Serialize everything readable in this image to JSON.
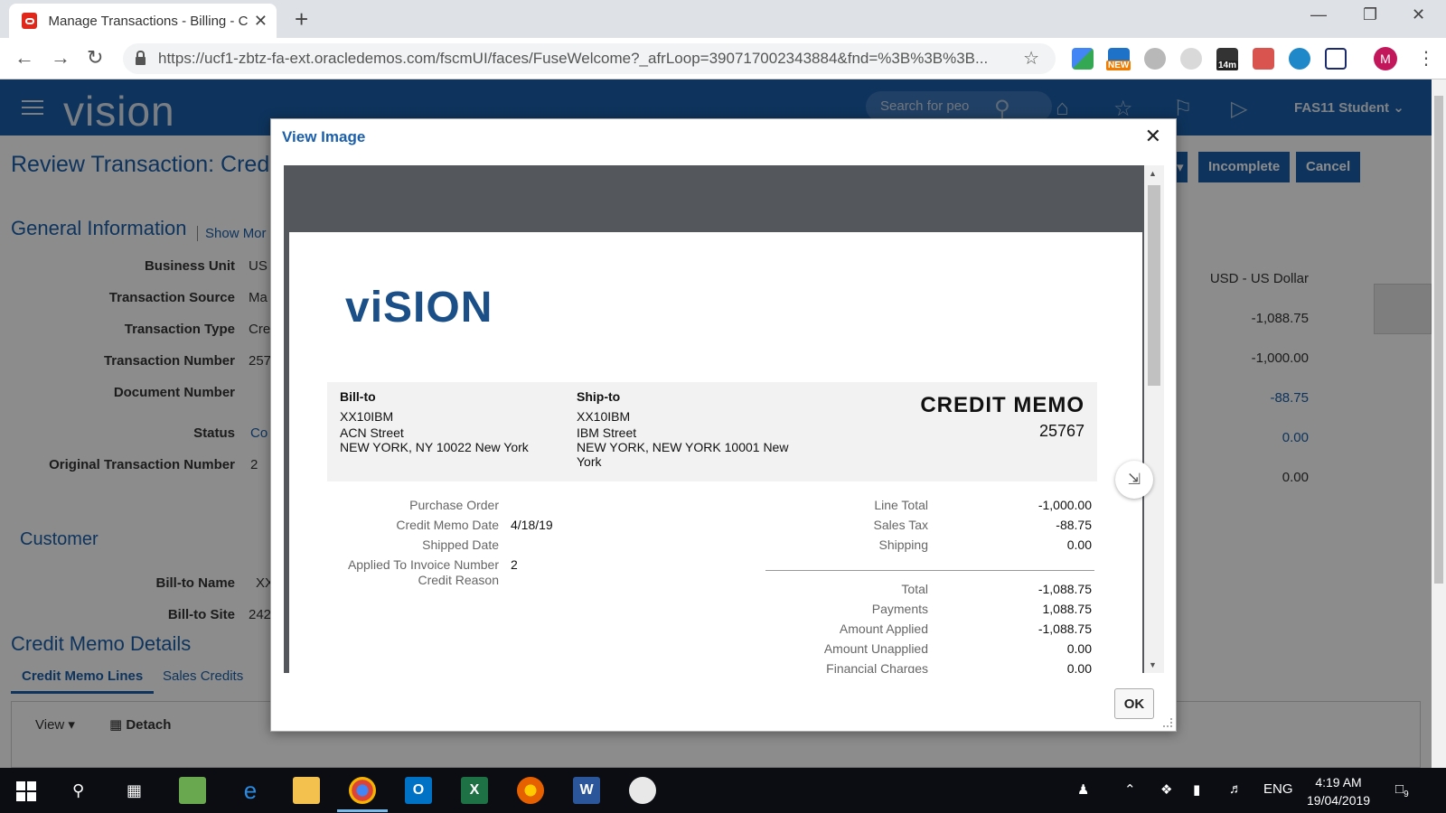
{
  "browser": {
    "tab_title": "Manage Transactions - Billing - C",
    "tab_close": "✕",
    "new_tab": "+",
    "url": "https://ucf1-zbtz-fa-ext.oracledemos.com/fscmUI/faces/FuseWelcome?_afrLoop=390717002343884&fnd=%3B%3B%3B...",
    "profile_initial": "M",
    "ext_badges": {
      "new": "NEW",
      "timer": "14m"
    }
  },
  "app": {
    "logo": "vision",
    "search_placeholder": "Search for peo",
    "user": "FAS11 Student",
    "page_title": "Review Transaction: Cred",
    "buttons": {
      "incomplete": "Incomplete",
      "cancel": "Cancel"
    },
    "general": {
      "heading": "General Information",
      "show_more": "Show Mor",
      "fields": [
        {
          "label": "Business Unit",
          "value": "US"
        },
        {
          "label": "Transaction Source",
          "value": "Ma"
        },
        {
          "label": "Transaction Type",
          "value": "Cre"
        },
        {
          "label": "Transaction Number",
          "value": "257"
        },
        {
          "label": "Document Number",
          "value": ""
        },
        {
          "label": "Status",
          "value": "Co"
        },
        {
          "label": "Original Transaction Number",
          "value": "2"
        }
      ]
    },
    "right_values": [
      "USD - US Dollar",
      "-1,088.75",
      "-1,000.00",
      "-88.75",
      "0.00",
      "0.00"
    ],
    "customer": {
      "heading": "Customer",
      "bill_to_name_label": "Bill-to Name",
      "bill_to_name_value": "XX",
      "bill_to_site_label": "Bill-to Site",
      "bill_to_site_value": "242"
    },
    "credit_memo_details": {
      "heading": "Credit Memo Details",
      "tabs": [
        "Credit Memo Lines",
        "Sales Credits"
      ],
      "view_label": "View",
      "detach_label": "Detach"
    }
  },
  "dialog": {
    "title": "View Image",
    "close_label": "✕",
    "ok_label": "OK",
    "document": {
      "logo": "viSION",
      "bill_to": {
        "heading": "Bill-to",
        "lines": [
          "XX10IBM",
          "ACN Street",
          "NEW YORK, NY 10022 New York"
        ]
      },
      "ship_to": {
        "heading": "Ship-to",
        "lines": [
          "XX10IBM",
          "IBM Street",
          "NEW YORK, NEW YORK 10001 New",
          "York"
        ]
      },
      "doc_type": "CREDIT MEMO",
      "doc_number": "25767",
      "details": [
        {
          "label": "Purchase Order",
          "value": ""
        },
        {
          "label": "Credit Memo Date",
          "value": "4/18/19"
        },
        {
          "label": "Shipped Date",
          "value": ""
        },
        {
          "label": "Applied To Invoice Number",
          "value": "2"
        },
        {
          "label": "Credit Reason",
          "value": ""
        }
      ],
      "totals_top": [
        {
          "label": "Line Total",
          "value": "-1,000.00"
        },
        {
          "label": "Sales Tax",
          "value": "-88.75"
        },
        {
          "label": "Shipping",
          "value": "0.00"
        }
      ],
      "totals_bottom": [
        {
          "label": "Total",
          "value": "-1,088.75"
        },
        {
          "label": "Payments",
          "value": "1,088.75"
        },
        {
          "label": "Amount Applied",
          "value": "-1,088.75"
        },
        {
          "label": "Amount Unapplied",
          "value": "0.00"
        },
        {
          "label": "Financial Charges",
          "value": "0.00"
        }
      ]
    }
  },
  "taskbar": {
    "language": "ENG",
    "time": "4:19 AM",
    "date": "19/04/2019",
    "notification_count": "9"
  }
}
